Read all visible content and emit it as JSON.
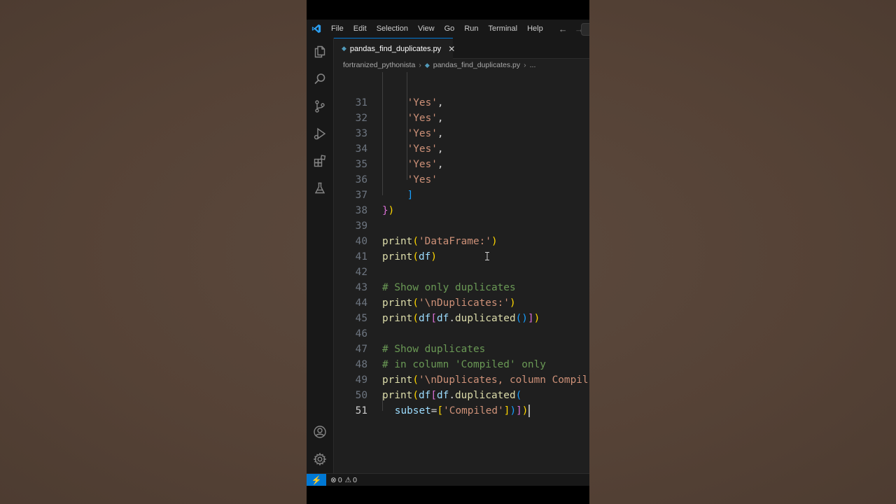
{
  "menu": {
    "items": [
      "File",
      "Edit",
      "Selection",
      "View",
      "Go",
      "Run",
      "Terminal",
      "Help"
    ]
  },
  "tab": {
    "label": "pandas_find_duplicates.py",
    "close_glyph": "✕"
  },
  "breadcrumb": {
    "folder": "fortranized_pythonista",
    "file": "pandas_find_duplicates.py",
    "more": "..."
  },
  "editor": {
    "lines": [
      {
        "n": "31",
        "indent": 4,
        "tokens": [
          [
            "s",
            "'Yes'"
          ],
          [
            "p",
            ","
          ]
        ]
      },
      {
        "n": "32",
        "indent": 4,
        "tokens": [
          [
            "s",
            "'Yes'"
          ],
          [
            "p",
            ","
          ]
        ]
      },
      {
        "n": "33",
        "indent": 4,
        "tokens": [
          [
            "s",
            "'Yes'"
          ],
          [
            "p",
            ","
          ]
        ]
      },
      {
        "n": "34",
        "indent": 4,
        "tokens": [
          [
            "s",
            "'Yes'"
          ],
          [
            "p",
            ","
          ]
        ]
      },
      {
        "n": "35",
        "indent": 4,
        "tokens": [
          [
            "s",
            "'Yes'"
          ],
          [
            "p",
            ","
          ]
        ]
      },
      {
        "n": "36",
        "indent": 4,
        "tokens": [
          [
            "s",
            "'Yes'"
          ]
        ]
      },
      {
        "n": "37",
        "indent": 4,
        "tokens": [
          [
            "b3",
            "]"
          ]
        ]
      },
      {
        "n": "38",
        "indent": 0,
        "tokens": [
          [
            "b2",
            "}"
          ],
          [
            "b1",
            ")"
          ]
        ]
      },
      {
        "n": "39",
        "indent": 0,
        "tokens": []
      },
      {
        "n": "40",
        "indent": 0,
        "tokens": [
          [
            "k",
            "print"
          ],
          [
            "b1",
            "("
          ],
          [
            "s",
            "'DataFrame:'"
          ],
          [
            "b1",
            ")"
          ]
        ]
      },
      {
        "n": "41",
        "indent": 0,
        "tokens": [
          [
            "k",
            "print"
          ],
          [
            "b1",
            "("
          ],
          [
            "v",
            "df"
          ],
          [
            "b1",
            ")"
          ]
        ]
      },
      {
        "n": "42",
        "indent": 0,
        "tokens": []
      },
      {
        "n": "43",
        "indent": 0,
        "tokens": [
          [
            "c",
            "# Show only duplicates"
          ]
        ]
      },
      {
        "n": "44",
        "indent": 0,
        "tokens": [
          [
            "k",
            "print"
          ],
          [
            "b1",
            "("
          ],
          [
            "s",
            "'\\nDuplicates:'"
          ],
          [
            "b1",
            ")"
          ]
        ]
      },
      {
        "n": "45",
        "indent": 0,
        "tokens": [
          [
            "k",
            "print"
          ],
          [
            "b1",
            "("
          ],
          [
            "v",
            "df"
          ],
          [
            "b2",
            "["
          ],
          [
            "v",
            "df"
          ],
          [
            "p",
            "."
          ],
          [
            "k",
            "duplicated"
          ],
          [
            "b3",
            "()"
          ],
          [
            "b2",
            "]"
          ],
          [
            "b1",
            ")"
          ]
        ]
      },
      {
        "n": "46",
        "indent": 0,
        "tokens": []
      },
      {
        "n": "47",
        "indent": 0,
        "tokens": [
          [
            "c",
            "# Show duplicates"
          ]
        ]
      },
      {
        "n": "48",
        "indent": 0,
        "tokens": [
          [
            "c",
            "# in column 'Compiled' only"
          ]
        ]
      },
      {
        "n": "49",
        "indent": 0,
        "tokens": [
          [
            "k",
            "print"
          ],
          [
            "b1",
            "("
          ],
          [
            "s",
            "'\\nDuplicates, column Compil"
          ]
        ]
      },
      {
        "n": "50",
        "indent": 0,
        "tokens": [
          [
            "k",
            "print"
          ],
          [
            "b1",
            "("
          ],
          [
            "v",
            "df"
          ],
          [
            "b2",
            "["
          ],
          [
            "v",
            "df"
          ],
          [
            "p",
            "."
          ],
          [
            "k",
            "duplicated"
          ],
          [
            "b3",
            "("
          ]
        ]
      },
      {
        "n": "51",
        "indent": 2,
        "active": true,
        "tokens": [
          [
            "v",
            "subset"
          ],
          [
            "p",
            "="
          ],
          [
            "b1",
            "["
          ],
          [
            "s",
            "'Compiled'"
          ],
          [
            "b1",
            "]"
          ],
          [
            "b3",
            ")"
          ],
          [
            "b2",
            "]"
          ],
          [
            "b1",
            ")"
          ]
        ]
      }
    ]
  },
  "statusbar": {
    "errors": "0",
    "warnings": "0"
  },
  "colors": {
    "accent": "#0078d4",
    "string": "#ce9178",
    "function": "#dcdcaa",
    "variable": "#9cdcfe",
    "comment": "#6a9955",
    "bracket1": "#ffd700",
    "bracket2": "#da70d6",
    "bracket3": "#179fff"
  }
}
